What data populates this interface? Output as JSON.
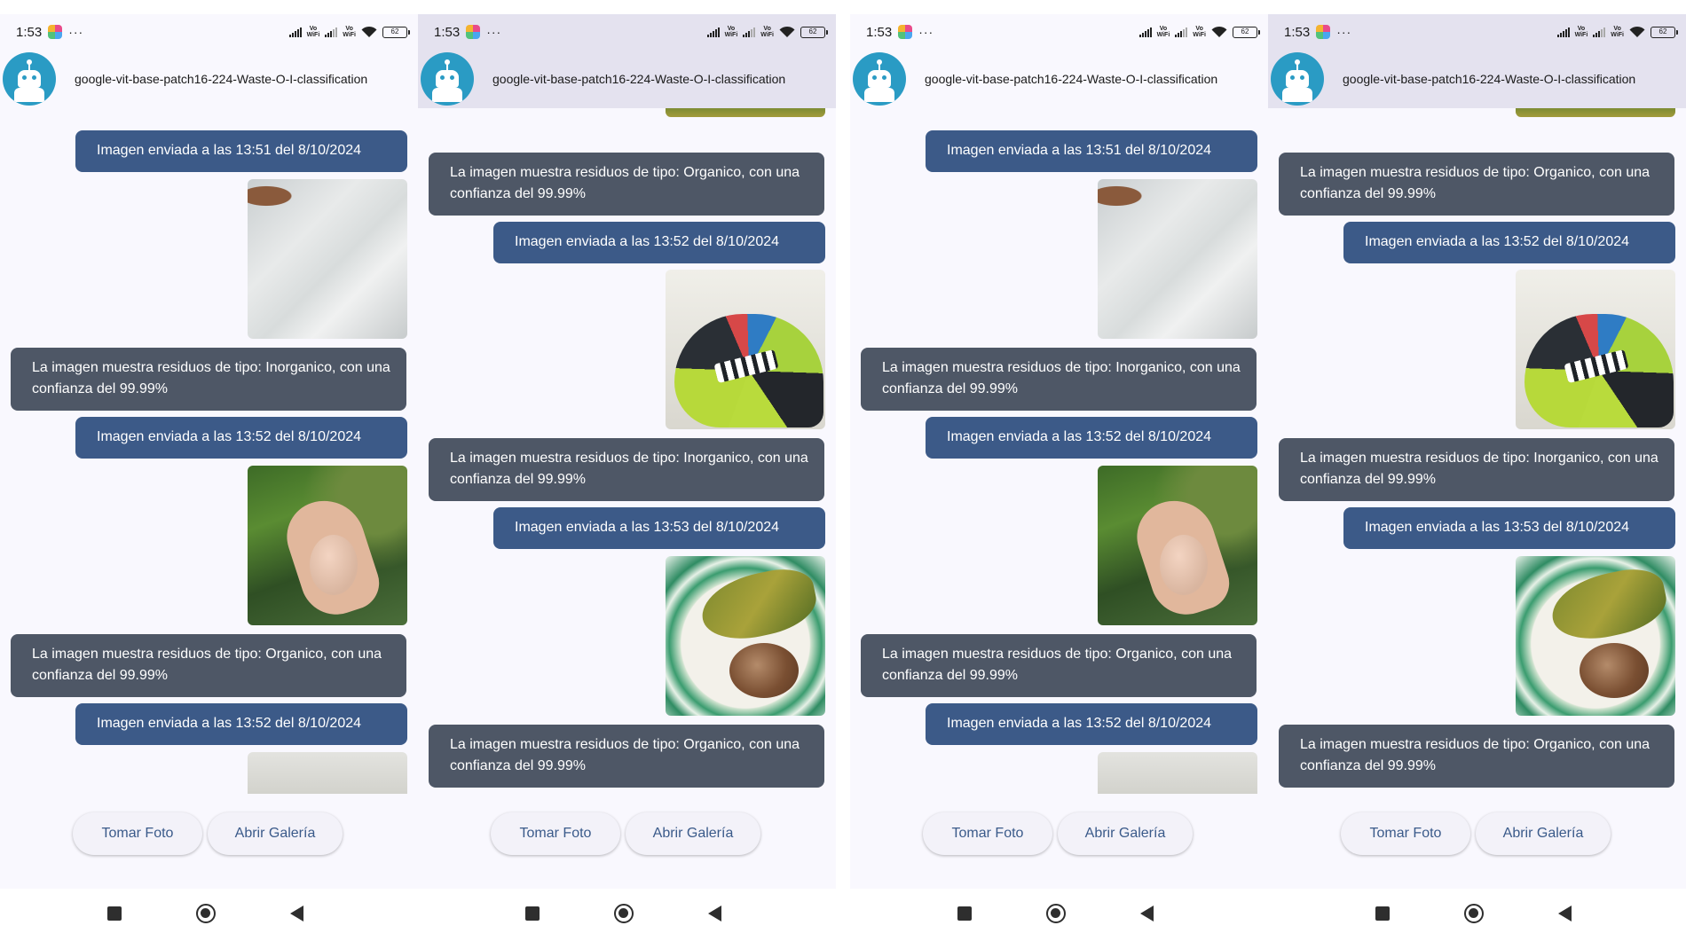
{
  "status_bar": {
    "time": "1:53",
    "dots": "···",
    "vowifi": "Vo\nWiFi",
    "battery": "62"
  },
  "header": {
    "title": "google-vit-base-patch16-224-Waste-O-I-classification"
  },
  "messages": {
    "sent_1351": "Imagen enviada a las 13:51 del 8/10/2024",
    "sent_1352": "Imagen enviada a las 13:52 del 8/10/2024",
    "sent_1353": "Imagen enviada a las 13:53 del 8/10/2024",
    "result_inorganico": "La imagen muestra residuos de tipo: Inorganico, con una confianza del 99.99%",
    "result_organico": "La imagen muestra residuos de tipo: Organico, con una confianza del 99.99%"
  },
  "actions": {
    "take_photo": "Tomar Foto",
    "open_gallery": "Abrir Galería"
  },
  "icons": {
    "avatar": "robot-icon",
    "status": [
      "signal-icon",
      "signal-icon",
      "wifi-icon",
      "battery-icon"
    ],
    "nav": [
      "recents-square-icon",
      "home-circle-icon",
      "back-triangle-icon"
    ]
  },
  "colors": {
    "sent_bubble": "#3c5a88",
    "received_bubble": "#4e5766",
    "avatar": "#2a9bc4",
    "button_text": "#3a5a8a",
    "header_bg_scrolled": "#e4e2ef"
  },
  "screens": [
    {
      "id": "screen-1",
      "state": "scrolled-top"
    },
    {
      "id": "screen-2",
      "state": "scrolled-bottom"
    },
    {
      "id": "screen-3",
      "state": "scrolled-top"
    },
    {
      "id": "screen-4",
      "state": "scrolled-bottom"
    }
  ]
}
